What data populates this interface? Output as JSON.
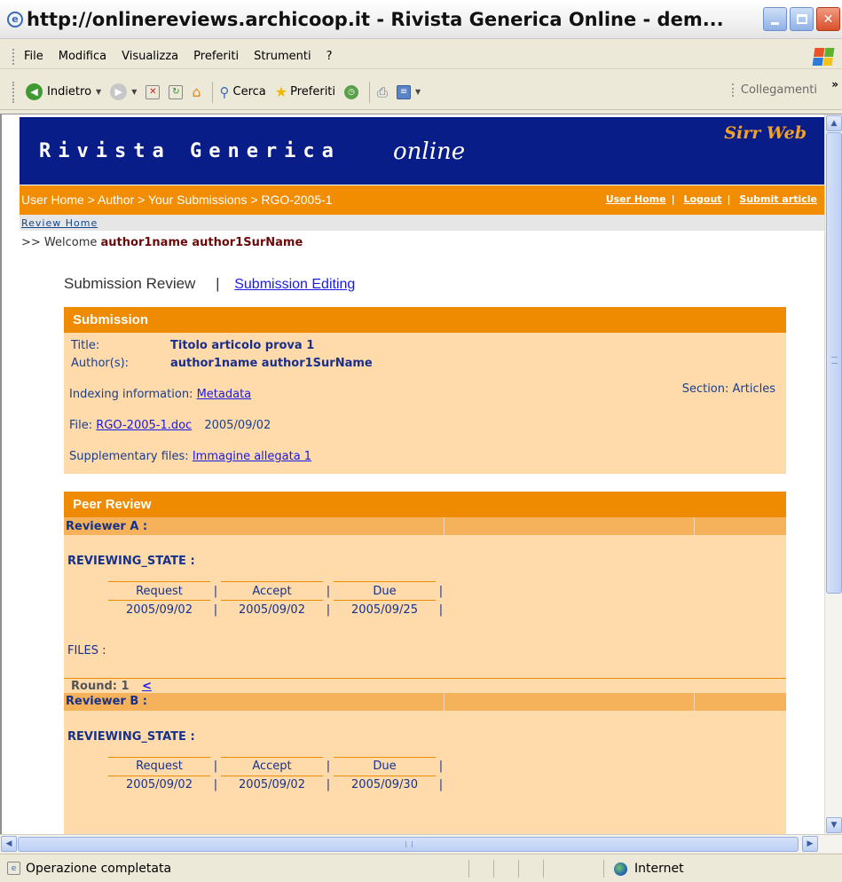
{
  "window": {
    "title": "http://onlinereviews.archicoop.it - Rivista Generica Online - dem...",
    "ie_glyph": "e"
  },
  "menu": [
    "File",
    "Modifica",
    "Visualizza",
    "Preferiti",
    "Strumenti",
    "?"
  ],
  "toolbar": {
    "back_label": "Indietro",
    "search_label": "Cerca",
    "favorites_label": "Preferiti",
    "links_label": "Collegamenti",
    "overflow": "»"
  },
  "header": {
    "brand": "Rivista Generica",
    "brand_suffix": "online",
    "brand_right": "Sirr Web",
    "colors": {
      "banner": "#081d88",
      "orange": "#f28c00",
      "box": "#ffdaaa"
    }
  },
  "breadcrumb": {
    "path": "User Home > Author > Your Submissions > RGO-2005-1",
    "user_home": "User Home",
    "logout": "Logout",
    "submit": "Submit article",
    "separator": "|"
  },
  "subnav": {
    "review_home": "Review Home"
  },
  "welcome": {
    "prefix": ">> Welcome",
    "name": "author1name author1SurName"
  },
  "tabs": {
    "current": "Submission Review",
    "separator": "|",
    "other": "Submission Editing"
  },
  "submission": {
    "heading": "Submission",
    "title_label": "Title:",
    "title_value": "Titolo articolo prova 1",
    "authors_label": "Author(s):",
    "authors_value": "author1name author1SurName",
    "indexing_label": "Indexing information:",
    "indexing_link": "Metadata",
    "section_text": "Section:  Articles",
    "file_label": "File:",
    "file_link": "RGO-2005-1.doc",
    "file_date": "2005/09/02",
    "supp_label": "Supplementary files:",
    "supp_link": "Immagine allegata 1"
  },
  "peer_review": {
    "heading": "Peer Review",
    "reviewers": [
      {
        "name": "Reviewer A :",
        "state": "REVIEWING_STATE :",
        "headers": [
          "Request",
          "Accept",
          "Due"
        ],
        "values": [
          "2005/09/02",
          "2005/09/02",
          "2005/09/25"
        ],
        "files": "FILES :",
        "round": "Round: 1",
        "round_link": "<"
      },
      {
        "name": "Reviewer B :",
        "state": "REVIEWING_STATE :",
        "headers": [
          "Request",
          "Accept",
          "Due"
        ],
        "values": [
          "2005/09/02",
          "2005/09/02",
          "2005/09/30"
        ]
      }
    ],
    "pipe": "|"
  },
  "status": {
    "text": "Operazione completata",
    "zone": "Internet"
  }
}
